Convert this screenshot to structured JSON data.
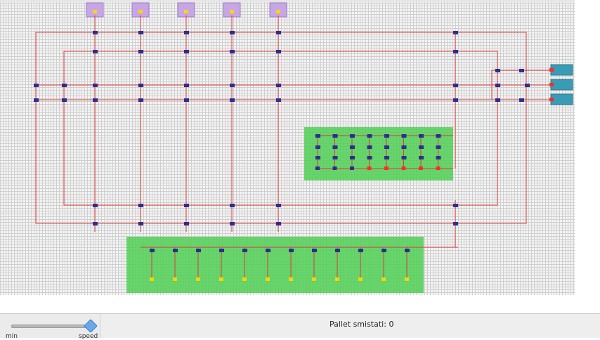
{
  "status": {
    "label": "Pallet smistati:",
    "count": "0"
  },
  "speed_slider": {
    "min_label": "min",
    "max_label": "speed",
    "value_percent": 95
  },
  "colors": {
    "track": "#e03a3a",
    "zone_green": "#4fcf55",
    "input_bay": "#c7a6e6",
    "output_bay": "#3a9bb4",
    "node": "#2b2f8f",
    "marker": "#ffd400",
    "alert": "#ff2a2a"
  }
}
